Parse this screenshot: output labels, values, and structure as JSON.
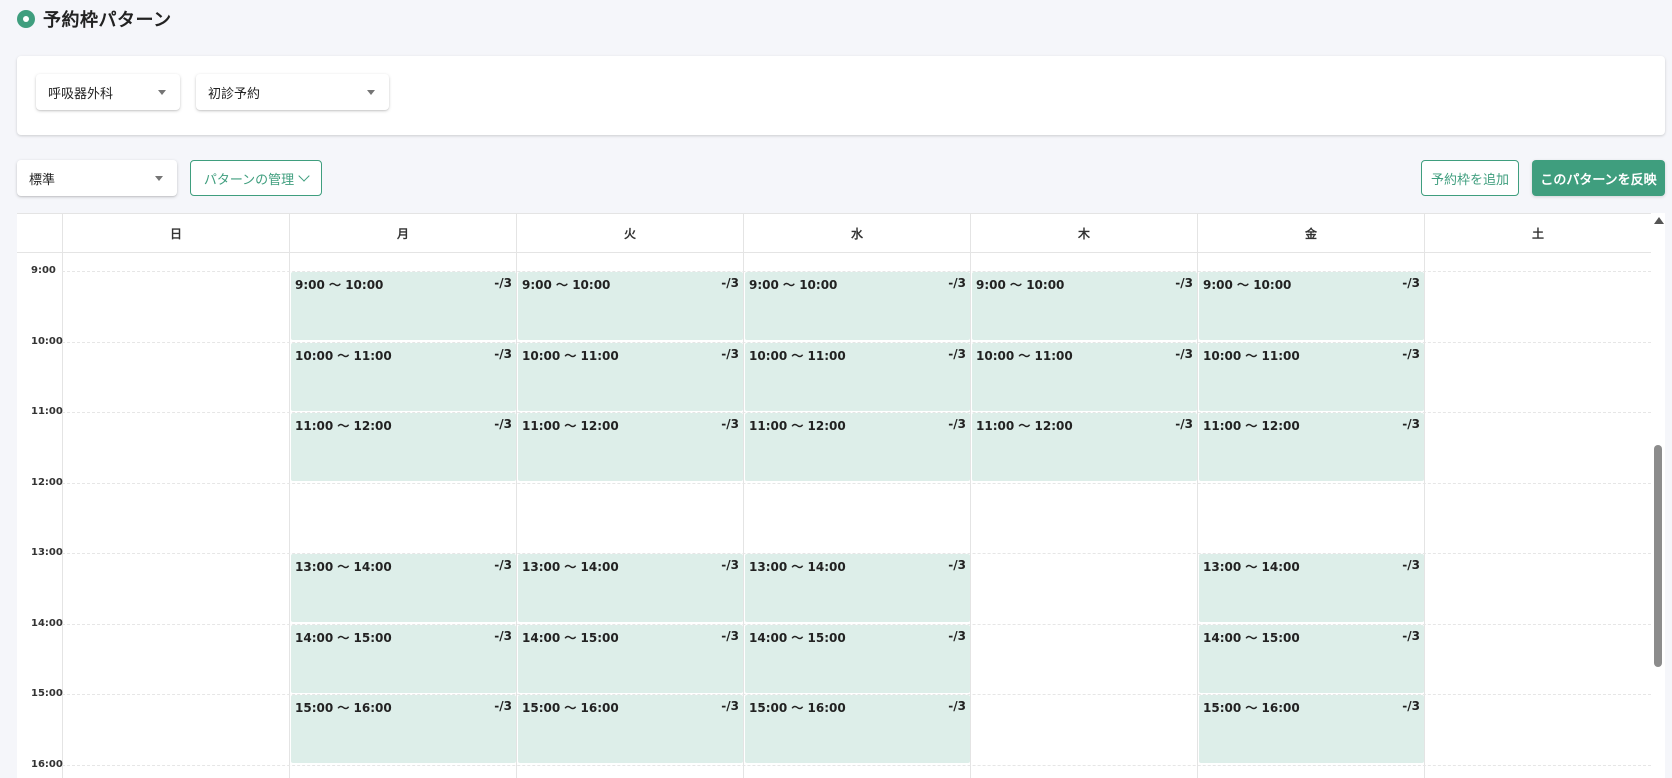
{
  "header": {
    "title": "予約枠パターン"
  },
  "filters": {
    "department": "呼吸器外科",
    "reservation_type": "初診予約"
  },
  "toolbar": {
    "pattern": "標準",
    "manage_label": "パターンの管理",
    "add_label": "予約枠を追加",
    "apply_label": "このパターンを反映"
  },
  "calendar": {
    "days": [
      "日",
      "月",
      "火",
      "水",
      "木",
      "金",
      "土"
    ],
    "hours": [
      "9:00",
      "10:00",
      "11:00",
      "12:00",
      "13:00",
      "14:00",
      "15:00",
      "16:00"
    ],
    "slots": [
      {
        "day": 1,
        "start": 0,
        "label": "9:00 ～ 10:00",
        "capacity": "-/3"
      },
      {
        "day": 1,
        "start": 1,
        "label": "10:00 ～ 11:00",
        "capacity": "-/3"
      },
      {
        "day": 1,
        "start": 2,
        "label": "11:00 ～ 12:00",
        "capacity": "-/3"
      },
      {
        "day": 1,
        "start": 4,
        "label": "13:00 ～ 14:00",
        "capacity": "-/3"
      },
      {
        "day": 1,
        "start": 5,
        "label": "14:00 ～ 15:00",
        "capacity": "-/3"
      },
      {
        "day": 1,
        "start": 6,
        "label": "15:00 ～ 16:00",
        "capacity": "-/3"
      },
      {
        "day": 2,
        "start": 0,
        "label": "9:00 ～ 10:00",
        "capacity": "-/3"
      },
      {
        "day": 2,
        "start": 1,
        "label": "10:00 ～ 11:00",
        "capacity": "-/3"
      },
      {
        "day": 2,
        "start": 2,
        "label": "11:00 ～ 12:00",
        "capacity": "-/3"
      },
      {
        "day": 2,
        "start": 4,
        "label": "13:00 ～ 14:00",
        "capacity": "-/3"
      },
      {
        "day": 2,
        "start": 5,
        "label": "14:00 ～ 15:00",
        "capacity": "-/3"
      },
      {
        "day": 2,
        "start": 6,
        "label": "15:00 ～ 16:00",
        "capacity": "-/3"
      },
      {
        "day": 3,
        "start": 0,
        "label": "9:00 ～ 10:00",
        "capacity": "-/3"
      },
      {
        "day": 3,
        "start": 1,
        "label": "10:00 ～ 11:00",
        "capacity": "-/3"
      },
      {
        "day": 3,
        "start": 2,
        "label": "11:00 ～ 12:00",
        "capacity": "-/3"
      },
      {
        "day": 3,
        "start": 4,
        "label": "13:00 ～ 14:00",
        "capacity": "-/3"
      },
      {
        "day": 3,
        "start": 5,
        "label": "14:00 ～ 15:00",
        "capacity": "-/3"
      },
      {
        "day": 3,
        "start": 6,
        "label": "15:00 ～ 16:00",
        "capacity": "-/3"
      },
      {
        "day": 4,
        "start": 0,
        "label": "9:00 ～ 10:00",
        "capacity": "-/3"
      },
      {
        "day": 4,
        "start": 1,
        "label": "10:00 ～ 11:00",
        "capacity": "-/3"
      },
      {
        "day": 4,
        "start": 2,
        "label": "11:00 ～ 12:00",
        "capacity": "-/3"
      },
      {
        "day": 5,
        "start": 0,
        "label": "9:00 ～ 10:00",
        "capacity": "-/3"
      },
      {
        "day": 5,
        "start": 1,
        "label": "10:00 ～ 11:00",
        "capacity": "-/3"
      },
      {
        "day": 5,
        "start": 2,
        "label": "11:00 ～ 12:00",
        "capacity": "-/3"
      },
      {
        "day": 5,
        "start": 4,
        "label": "13:00 ～ 14:00",
        "capacity": "-/3"
      },
      {
        "day": 5,
        "start": 5,
        "label": "14:00 ～ 15:00",
        "capacity": "-/3"
      },
      {
        "day": 5,
        "start": 6,
        "label": "15:00 ～ 16:00",
        "capacity": "-/3"
      }
    ]
  },
  "colors": {
    "accent": "#3f9e7e",
    "slot_bg": "#ddeee9"
  }
}
